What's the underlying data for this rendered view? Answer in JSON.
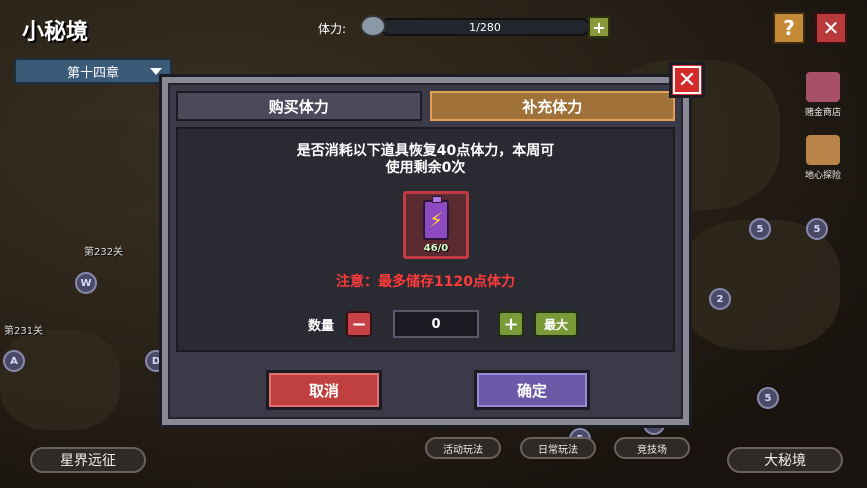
{
  "hud": {
    "title": "小秘境",
    "chapter": "第十四章",
    "stamina_label": "体力:",
    "stamina_value": "1/280",
    "stamina_fill": 0.004,
    "stamina_plus": "+",
    "help": "?",
    "close": "✕"
  },
  "side_buttons": {
    "shop": "赌金商店",
    "explore": "地心探险"
  },
  "stages": {
    "stage_232": "第232关",
    "stage_231": "第231关"
  },
  "map_markers": [
    "5",
    "5",
    "5",
    "5",
    "2",
    "5",
    "5",
    "5",
    "W",
    "A",
    "D"
  ],
  "bottom_bar": {
    "left": "星界远征",
    "activity": "活动玩法",
    "daily": "日常玩法",
    "arena": "竞技场",
    "right": "大秘境"
  },
  "dialog": {
    "tabs": {
      "buy": "购买体力",
      "refill": "补充体力"
    },
    "description_line1": "是否消耗以下道具恢复40点体力，本周可",
    "description_line2": "使用剩余0次",
    "item_name": "battery-icon",
    "item_count": "46/0",
    "warning": "注意：最多储存1120点体力",
    "quantity_label": "数量",
    "minus": "−",
    "quantity_value": "0",
    "plus": "+",
    "max": "最大",
    "cancel": "取消",
    "confirm": "确定",
    "close": "✕"
  },
  "colors": {
    "tab_active": "#a0723a",
    "cancel": "#c04040",
    "confirm": "#6a5aa8",
    "warning": "#ff3a3a",
    "close": "#d42a2a"
  }
}
